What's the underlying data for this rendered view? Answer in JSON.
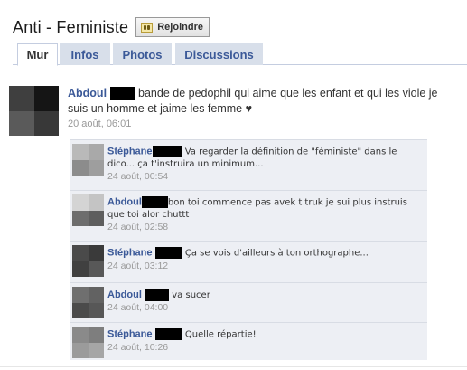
{
  "header": {
    "title": "Anti - Feministe",
    "join_label": "Rejoindre"
  },
  "tabs": [
    {
      "label": "Mur",
      "active": true
    },
    {
      "label": "Infos",
      "active": false
    },
    {
      "label": "Photos",
      "active": false
    },
    {
      "label": "Discussions",
      "active": false
    }
  ],
  "post": {
    "author": "Abdoul",
    "text": "bande de pedophil qui aime que les enfant et qui les viole je suis un homme et jaime les femme ♥",
    "time": "20 août, 06:01"
  },
  "comments": [
    {
      "author": "Stéphane",
      "text": "Va regarder la définition de \"féministe\" dans le dico... ça t'instruira un minimum...",
      "time": "24 août, 00:54"
    },
    {
      "author": "Abdoul",
      "text": "bon toi commence pas avek t truk je sui plus instruis que toi alor chuttt",
      "time": "24 août, 02:58"
    },
    {
      "author": "Stéphane",
      "text": "Ça se vois d'ailleurs à ton orthographe...",
      "time": "24 août, 03:12"
    },
    {
      "author": "Abdoul",
      "text": "va sucer",
      "time": "24 août, 04:00"
    },
    {
      "author": "Stéphane",
      "text": "Quelle répartie!",
      "time": "24 août, 10:26"
    }
  ],
  "colors": {
    "link": "#3b5998",
    "tab_bg": "#d8dfea",
    "comment_bg": "#edeff4",
    "redaction": "#000000"
  },
  "icons": {
    "join": "join-group-icon",
    "avatar": "blurred-profile-avatar"
  }
}
